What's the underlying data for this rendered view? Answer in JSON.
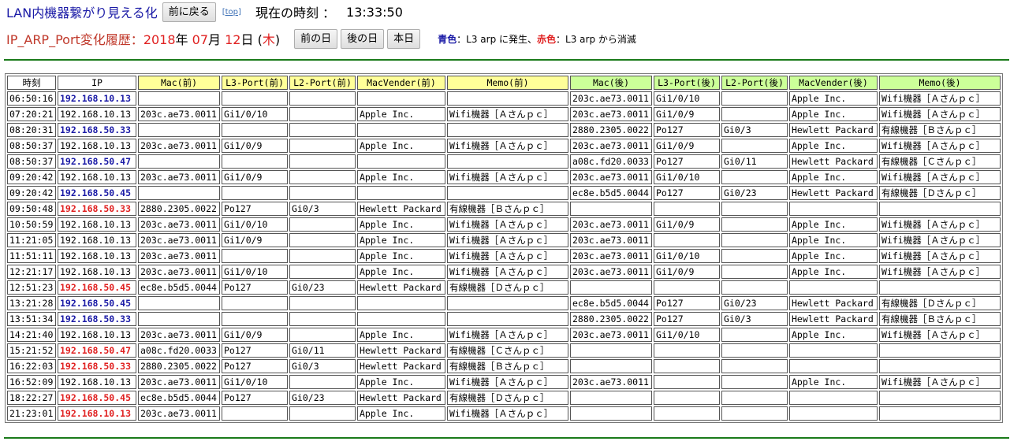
{
  "header": {
    "app_title": "LAN内機器繋がり見える化",
    "back_button": "前に戻る",
    "top_link": "[top]",
    "clock_label": "現在の時刻 ：",
    "clock_value": "13:33:50"
  },
  "history": {
    "title": "IP_ARP_Port変化履歴：",
    "year": "2018",
    "year_unit": "年",
    "month": "07",
    "month_unit": "月",
    "day": "12",
    "day_unit": "日",
    "weekday_open": "(",
    "weekday": "木",
    "weekday_close": ")",
    "prev_day_button": "前の日",
    "next_day_button": "後の日",
    "today_button": "本日",
    "legend_blue_label": "青色",
    "legend_blue_text": "：L3 arp に発生、",
    "legend_red_label": "赤色",
    "legend_red_text": "：L3 arp から消滅"
  },
  "colors": {
    "accent_green": "#1a7a1a",
    "before_header": "#ffff99",
    "after_header": "#ccff99",
    "ip_new": "#1a1aa6",
    "ip_gone": "#e02020"
  },
  "table": {
    "columns": [
      {
        "label": "時刻",
        "group": "plain"
      },
      {
        "label": "IP",
        "group": "plain"
      },
      {
        "label": "Mac(前)",
        "group": "before"
      },
      {
        "label": "L3-Port(前)",
        "group": "before"
      },
      {
        "label": "L2-Port(前)",
        "group": "before"
      },
      {
        "label": "MacVender(前)",
        "group": "before"
      },
      {
        "label": "Memo(前)",
        "group": "before"
      },
      {
        "label": "Mac(後)",
        "group": "after"
      },
      {
        "label": "L3-Port(後)",
        "group": "after"
      },
      {
        "label": "L2-Port(後)",
        "group": "after"
      },
      {
        "label": "MacVender(後)",
        "group": "after"
      },
      {
        "label": "Memo(後)",
        "group": "after"
      }
    ],
    "rows": [
      {
        "ip_color": "blue",
        "cells": [
          "06:50:16",
          "192.168.10.13",
          "",
          "",
          "",
          "",
          "",
          "203c.ae73.0011",
          "Gi1/0/10",
          "",
          "Apple Inc.",
          "Wifi機器［Ａさんｐｃ］"
        ]
      },
      {
        "ip_color": "plain",
        "cells": [
          "07:20:21",
          "192.168.10.13",
          "203c.ae73.0011",
          "Gi1/0/10",
          "",
          "Apple Inc.",
          "Wifi機器［Ａさんｐｃ］",
          "203c.ae73.0011",
          "Gi1/0/9",
          "",
          "Apple Inc.",
          "Wifi機器［Ａさんｐｃ］"
        ]
      },
      {
        "ip_color": "blue",
        "cells": [
          "08:20:31",
          "192.168.50.33",
          "",
          "",
          "",
          "",
          "",
          "2880.2305.0022",
          "Po127",
          "Gi0/3",
          "Hewlett Packard",
          "有線機器［Ｂさんｐｃ］"
        ]
      },
      {
        "ip_color": "plain",
        "cells": [
          "08:50:37",
          "192.168.10.13",
          "203c.ae73.0011",
          "Gi1/0/9",
          "",
          "Apple Inc.",
          "Wifi機器［Ａさんｐｃ］",
          "203c.ae73.0011",
          "Gi1/0/9",
          "",
          "Apple Inc.",
          "Wifi機器［Ａさんｐｃ］"
        ]
      },
      {
        "ip_color": "blue",
        "cells": [
          "08:50:37",
          "192.168.50.47",
          "",
          "",
          "",
          "",
          "",
          "a08c.fd20.0033",
          "Po127",
          "Gi0/11",
          "Hewlett Packard",
          "有線機器［Ｃさんｐｃ］"
        ]
      },
      {
        "ip_color": "plain",
        "cells": [
          "09:20:42",
          "192.168.10.13",
          "203c.ae73.0011",
          "Gi1/0/9",
          "",
          "Apple Inc.",
          "Wifi機器［Ａさんｐｃ］",
          "203c.ae73.0011",
          "Gi1/0/10",
          "",
          "Apple Inc.",
          "Wifi機器［Ａさんｐｃ］"
        ]
      },
      {
        "ip_color": "blue",
        "cells": [
          "09:20:42",
          "192.168.50.45",
          "",
          "",
          "",
          "",
          "",
          "ec8e.b5d5.0044",
          "Po127",
          "Gi0/23",
          "Hewlett Packard",
          "有線機器［Ｄさんｐｃ］"
        ]
      },
      {
        "ip_color": "red",
        "cells": [
          "09:50:48",
          "192.168.50.33",
          "2880.2305.0022",
          "Po127",
          "Gi0/3",
          "Hewlett Packard",
          "有線機器［Ｂさんｐｃ］",
          "",
          "",
          "",
          "",
          ""
        ]
      },
      {
        "ip_color": "plain",
        "cells": [
          "10:50:59",
          "192.168.10.13",
          "203c.ae73.0011",
          "Gi1/0/10",
          "",
          "Apple Inc.",
          "Wifi機器［Ａさんｐｃ］",
          "203c.ae73.0011",
          "Gi1/0/9",
          "",
          "Apple Inc.",
          "Wifi機器［Ａさんｐｃ］"
        ]
      },
      {
        "ip_color": "plain",
        "cells": [
          "11:21:05",
          "192.168.10.13",
          "203c.ae73.0011",
          "Gi1/0/9",
          "",
          "Apple Inc.",
          "Wifi機器［Ａさんｐｃ］",
          "203c.ae73.0011",
          "",
          "",
          "Apple Inc.",
          "Wifi機器［Ａさんｐｃ］"
        ]
      },
      {
        "ip_color": "plain",
        "cells": [
          "11:51:11",
          "192.168.10.13",
          "203c.ae73.0011",
          "",
          "",
          "Apple Inc.",
          "Wifi機器［Ａさんｐｃ］",
          "203c.ae73.0011",
          "Gi1/0/10",
          "",
          "Apple Inc.",
          "Wifi機器［Ａさんｐｃ］"
        ]
      },
      {
        "ip_color": "plain",
        "cells": [
          "12:21:17",
          "192.168.10.13",
          "203c.ae73.0011",
          "Gi1/0/10",
          "",
          "Apple Inc.",
          "Wifi機器［Ａさんｐｃ］",
          "203c.ae73.0011",
          "Gi1/0/9",
          "",
          "Apple Inc.",
          "Wifi機器［Ａさんｐｃ］"
        ]
      },
      {
        "ip_color": "red",
        "cells": [
          "12:51:23",
          "192.168.50.45",
          "ec8e.b5d5.0044",
          "Po127",
          "Gi0/23",
          "Hewlett Packard",
          "有線機器［Ｄさんｐｃ］",
          "",
          "",
          "",
          "",
          ""
        ]
      },
      {
        "ip_color": "blue",
        "cells": [
          "13:21:28",
          "192.168.50.45",
          "",
          "",
          "",
          "",
          "",
          "ec8e.b5d5.0044",
          "Po127",
          "Gi0/23",
          "Hewlett Packard",
          "有線機器［Ｄさんｐｃ］"
        ]
      },
      {
        "ip_color": "blue",
        "cells": [
          "13:51:34",
          "192.168.50.33",
          "",
          "",
          "",
          "",
          "",
          "2880.2305.0022",
          "Po127",
          "Gi0/3",
          "Hewlett Packard",
          "有線機器［Ｂさんｐｃ］"
        ]
      },
      {
        "ip_color": "plain",
        "cells": [
          "14:21:40",
          "192.168.10.13",
          "203c.ae73.0011",
          "Gi1/0/9",
          "",
          "Apple Inc.",
          "Wifi機器［Ａさんｐｃ］",
          "203c.ae73.0011",
          "Gi1/0/10",
          "",
          "Apple Inc.",
          "Wifi機器［Ａさんｐｃ］"
        ]
      },
      {
        "ip_color": "red",
        "cells": [
          "15:21:52",
          "192.168.50.47",
          "a08c.fd20.0033",
          "Po127",
          "Gi0/11",
          "Hewlett Packard",
          "有線機器［Ｃさんｐｃ］",
          "",
          "",
          "",
          "",
          ""
        ]
      },
      {
        "ip_color": "red",
        "cells": [
          "16:22:03",
          "192.168.50.33",
          "2880.2305.0022",
          "Po127",
          "Gi0/3",
          "Hewlett Packard",
          "有線機器［Ｂさんｐｃ］",
          "",
          "",
          "",
          "",
          ""
        ]
      },
      {
        "ip_color": "plain",
        "cells": [
          "16:52:09",
          "192.168.10.13",
          "203c.ae73.0011",
          "Gi1/0/10",
          "",
          "Apple Inc.",
          "Wifi機器［Ａさんｐｃ］",
          "203c.ae73.0011",
          "",
          "",
          "Apple Inc.",
          "Wifi機器［Ａさんｐｃ］"
        ]
      },
      {
        "ip_color": "red",
        "cells": [
          "18:22:27",
          "192.168.50.45",
          "ec8e.b5d5.0044",
          "Po127",
          "Gi0/23",
          "Hewlett Packard",
          "有線機器［Ｄさんｐｃ］",
          "",
          "",
          "",
          "",
          ""
        ]
      },
      {
        "ip_color": "red",
        "cells": [
          "21:23:01",
          "192.168.10.13",
          "203c.ae73.0011",
          "",
          "",
          "Apple Inc.",
          "Wifi機器［Ａさんｐｃ］",
          "",
          "",
          "",
          "",
          ""
        ]
      }
    ]
  }
}
